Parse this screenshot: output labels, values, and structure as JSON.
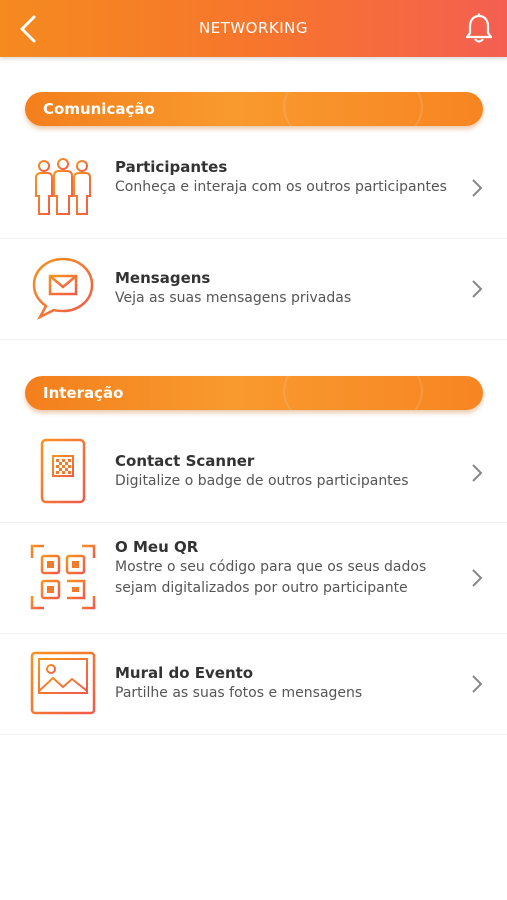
{
  "header": {
    "title": "NETWORKING",
    "back_icon": "chevron-left-icon",
    "bell_icon": "bell-icon",
    "gradient": [
      "#f58a1f",
      "#f45f52"
    ]
  },
  "sections": [
    {
      "label": "Comunicação",
      "items": [
        {
          "name": "Participantes",
          "desc": "Conheça e interaja com os outros participantes",
          "icon": "people-icon"
        },
        {
          "name": "Mensagens",
          "desc": "Veja as suas mensagens privadas",
          "icon": "message-bubble-icon"
        }
      ]
    },
    {
      "label": "Interação",
      "items": [
        {
          "name": "Contact Scanner",
          "desc": "Digitalize o badge de outros participantes",
          "icon": "phone-scanner-icon"
        },
        {
          "name": "O Meu QR",
          "desc": "Mostre o seu código para que os seus dados sejam digitalizados por outro participante",
          "icon": "qr-code-icon"
        },
        {
          "name": "Mural do Evento",
          "desc": "Partilhe as suas fotos e mensagens",
          "icon": "photo-wall-icon"
        }
      ]
    }
  ],
  "accent_color": "#f37f1c"
}
